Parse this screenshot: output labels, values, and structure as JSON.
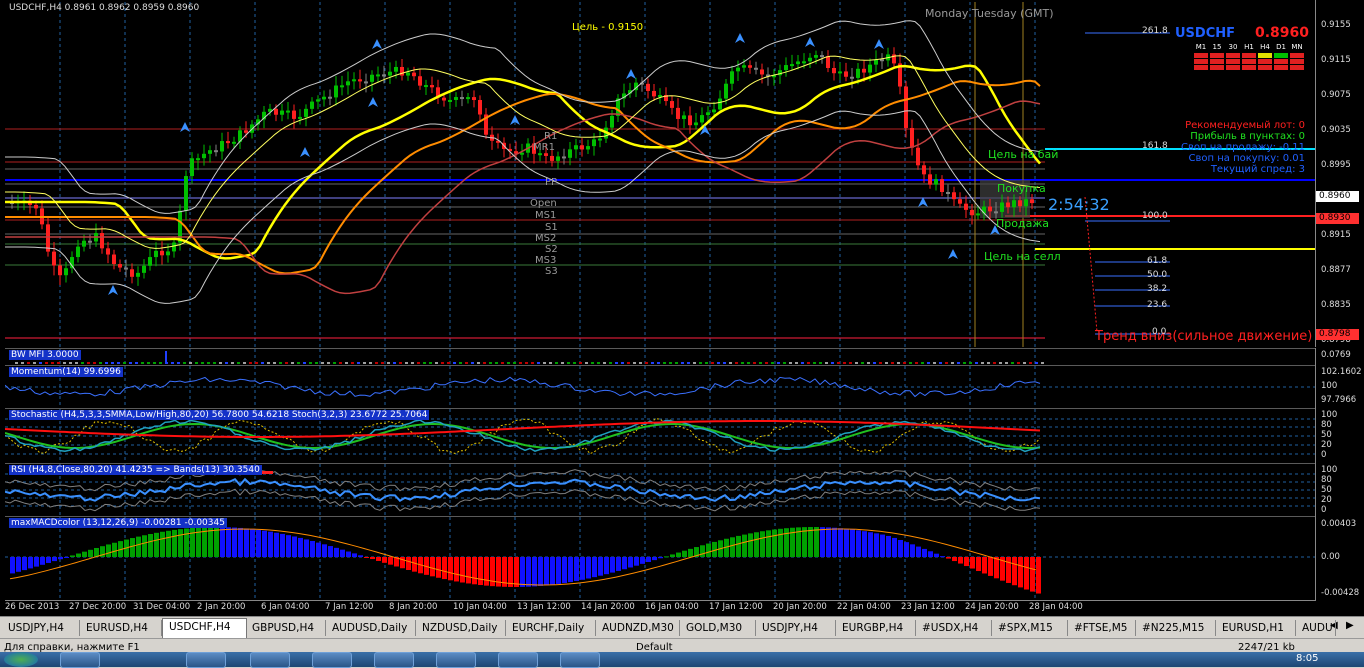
{
  "symbol_header": "USDCHF,H4  0.8961 0.8962 0.8959 0.8960",
  "time_label": "Monday Tuesday (GMT)",
  "target_label": "Цель - 0.9150",
  "info_panel": {
    "symbol": "USDCHF",
    "price": "0.8960",
    "timeframes": [
      "M1",
      "15",
      "30",
      "H1",
      "H4",
      "D1",
      "MN"
    ],
    "lines": [
      {
        "text": "Рекомендуемый лот: 0",
        "color": "#ff2020"
      },
      {
        "text": "Прибыль в пунктах: 0",
        "color": "#20e020"
      },
      {
        "text": "Своп на продажу: -0.11",
        "color": "#2060ff"
      },
      {
        "text": "Своп на покупку: 0.01",
        "color": "#2060ff"
      },
      {
        "text": "Текущий спред: 3",
        "color": "#2060ff"
      }
    ]
  },
  "chart_labels": {
    "buy_target": "Цель на бай",
    "buy": "Покупка",
    "sell": "Продажа",
    "sell_target": "Цель на селл",
    "countdown": "2:54:32",
    "trend": "Тренд вниз(сильное движение)",
    "pivots": [
      "R1",
      "MR1",
      "PP",
      "Open",
      "MS1",
      "S1",
      "MS2",
      "S2",
      "MS3",
      "S3"
    ]
  },
  "fib_levels": [
    "261.8",
    "161.8",
    "100.0",
    "61.8",
    "50.0",
    "38.2",
    "23.6",
    "0.0"
  ],
  "price_axis": [
    "0.9155",
    "0.9115",
    "0.9075",
    "0.9035",
    "0.8995",
    "0.8955",
    "0.8915",
    "0.8877",
    "0.8835",
    "0.8798"
  ],
  "price_tags": [
    {
      "value": "0.8960",
      "bg": "#ffffff"
    },
    {
      "value": "0.8930",
      "bg": "#ff3030"
    },
    {
      "value": "0.8798",
      "bg": "#ff3030"
    }
  ],
  "indicators": {
    "mfi": {
      "title": "BW MFI 3.0000",
      "axis": [
        "0.0769"
      ]
    },
    "momentum": {
      "title": "Momentum(14) 99.6996",
      "axis": [
        "102.1602",
        "100",
        "97.7966"
      ]
    },
    "stochastic": {
      "title": "Stochastic (H4,5,3,3,SMMA,Low/High,80,20) 56.7800 54.6218  Stoch(3,2,3) 23.6772 25.7064",
      "axis": [
        "100",
        "80",
        "50",
        "20",
        "0"
      ]
    },
    "rsi": {
      "title": "RSI (H4,8,Close,80,20) 41.4235  => Bands(13) 30.3540",
      "axis": [
        "100",
        "80",
        "50",
        "20",
        "0"
      ]
    },
    "macd": {
      "title": "maxMACDcolor (13,12,26,9) -0.00281 -0.00345",
      "axis": [
        "0.00403",
        "0.00",
        "-0.00428"
      ]
    }
  },
  "time_axis": [
    "26 Dec 2013",
    "27 Dec 20:00",
    "31 Dec 04:00",
    "2 Jan 20:00",
    "6 Jan 04:00",
    "7 Jan 12:00",
    "8 Jan 20:00",
    "10 Jan 04:00",
    "13 Jan 12:00",
    "14 Jan 20:00",
    "16 Jan 04:00",
    "17 Jan 12:00",
    "20 Jan 20:00",
    "22 Jan 04:00",
    "23 Jan 12:00",
    "24 Jan 20:00",
    "28 Jan 04:00"
  ],
  "tabs": [
    {
      "label": "USDJPY,H4",
      "active": false
    },
    {
      "label": "EURUSD,H4",
      "active": false
    },
    {
      "label": "USDCHF,H4",
      "active": true
    },
    {
      "label": "GBPUSD,H4",
      "active": false
    },
    {
      "label": "AUDUSD,Daily",
      "active": false
    },
    {
      "label": "NZDUSD,Daily",
      "active": false
    },
    {
      "label": "EURCHF,Daily",
      "active": false
    },
    {
      "label": "AUDNZD,M30",
      "active": false
    },
    {
      "label": "GOLD,M30",
      "active": false
    },
    {
      "label": "USDJPY,H4",
      "active": false
    },
    {
      "label": "EURGBP,H4",
      "active": false
    },
    {
      "label": "#USDX,H4",
      "active": false
    },
    {
      "label": "#SPX,M15",
      "active": false
    },
    {
      "label": "#FTSE,M5",
      "active": false
    },
    {
      "label": "#N225,M15",
      "active": false
    },
    {
      "label": "EURUSD,H1",
      "active": false
    },
    {
      "label": "AUDU",
      "active": false
    }
  ],
  "status_bar": {
    "help": "Для справки, нажмите F1",
    "profile": "Default",
    "traffic": "2247/21 kb",
    "clock": "8:05"
  },
  "colors": {
    "bull": "#00c000",
    "bear": "#ff2020",
    "doji": "#808080",
    "ma_yellow": "#ffff00",
    "ma_orange": "#ff8c00",
    "pivot_blue": "#0000ff",
    "macd_green": "#00a000",
    "macd_blue": "#1010ff",
    "macd_red": "#ff0000"
  }
}
